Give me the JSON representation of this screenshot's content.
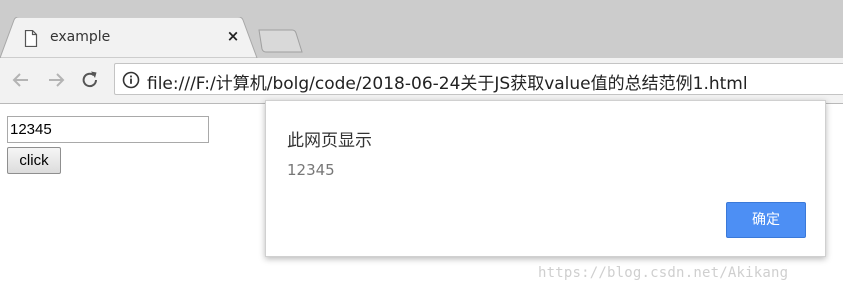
{
  "tab": {
    "title": "example",
    "close_symbol": "×",
    "icon": "file-icon"
  },
  "toolbar": {
    "back_icon": "back-arrow-icon",
    "forward_icon": "forward-arrow-icon",
    "reload_icon": "reload-icon",
    "info_icon": "info-icon",
    "url": "file:///F:/计算机/bolg/code/2018-06-24关于JS获取value值的总结范例1.html"
  },
  "page": {
    "input_value": "12345",
    "button_label": "click"
  },
  "dialog": {
    "title": "此网页显示",
    "message": "12345",
    "ok_label": "确定",
    "ok_color": "#4d8ff4"
  },
  "watermark": "https://blog.csdn.net/Akikang"
}
